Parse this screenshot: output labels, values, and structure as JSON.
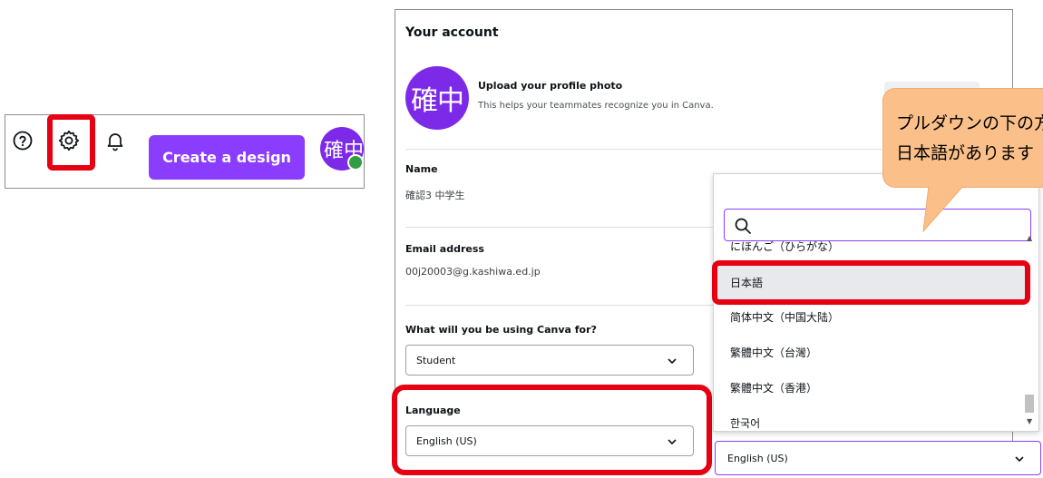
{
  "toolbar": {
    "help_icon": "question-circle-icon",
    "settings_icon": "gear-icon",
    "notifications_icon": "bell-icon",
    "create_button_label": "Create a design",
    "avatar_text": "確中"
  },
  "account": {
    "title": "Your account",
    "avatar_text": "確中",
    "upload_title": "Upload your profile photo",
    "upload_subtitle": "This helps your teammates recognize you in Canva.",
    "name_label": "Name",
    "name_value": "確認3 中学生",
    "email_label": "Email address",
    "email_value": "00j20003@g.kashiwa.ed.jp",
    "usage_label": "What will you be using Canva for?",
    "usage_value": "Student",
    "language_label": "Language",
    "language_value": "English (US)"
  },
  "dropdown": {
    "search_placeholder": "",
    "options": [
      "にほんご（ひらがな）",
      "日本語",
      "简体中文（中国大陆）",
      "繁體中文（台灣）",
      "繁體中文（香港）",
      "한국어"
    ],
    "selected_value": "English (US)"
  },
  "callout": {
    "line1": "プルダウンの下の方に",
    "line2": "日本語があります"
  },
  "colors": {
    "brand_purple": "#8b3dff",
    "highlight_red": "#e60012",
    "callout_orange": "#fbc08a"
  }
}
